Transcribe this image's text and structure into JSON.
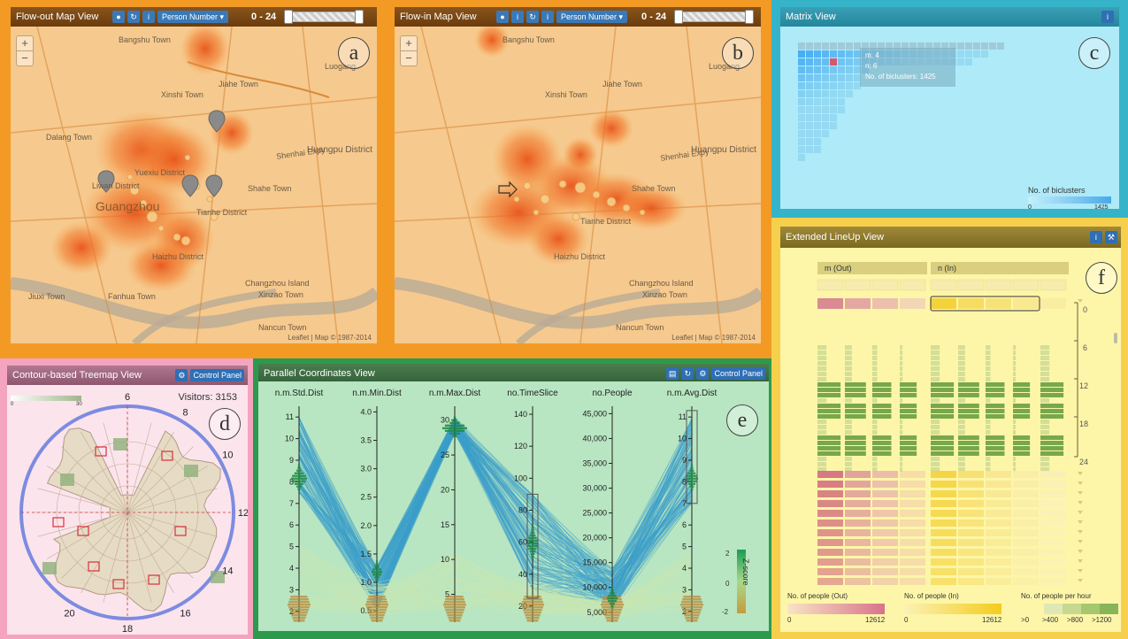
{
  "flow_out": {
    "title": "Flow-out Map View",
    "person_select": "Person Number ▾",
    "range": "0 - 24",
    "letter": "a",
    "attribution": "Leaflet | Map © 1987-2014",
    "labels": [
      "Bangshu Town",
      "Xinshi Town",
      "Jiahe Town",
      "Dalang Town",
      "Huangpu District",
      "Liwan District",
      "Shahe Town",
      "Tianhe District",
      "Yuexiu District",
      "Haizhu District",
      "Guangzhou",
      "Shenhai Expy",
      "Changzhou Island",
      "Xinzao Town",
      "Nancun Town",
      "Fanhua Town",
      "Jiuxi Town",
      "Luogang"
    ]
  },
  "flow_in": {
    "title": "Flow-in Map View",
    "person_select": "Person Number ▾",
    "range": "0 - 24",
    "letter": "b",
    "attribution": "Leaflet | Map © 1987-2014",
    "labels": [
      "Bangshu Town",
      "Xinshi Town",
      "Jiahe Town",
      "Huangpu District",
      "Shahe Town",
      "Tianhe District",
      "Haizhu District",
      "Shenhai Expy",
      "Changzhou Island",
      "Xinzao Town",
      "Nancun Town",
      "Luogang"
    ]
  },
  "matrix": {
    "title": "Matrix View",
    "letter": "c",
    "tooltip": {
      "m": "m: 4",
      "n": "n: 6",
      "biclusters": "No. of biclusters: 1425"
    },
    "legend_title": "No. of biclusters",
    "legend_min": "0",
    "legend_max": "1425"
  },
  "treemap": {
    "title": "Contour-based Treemap View",
    "control_panel": "Control Panel",
    "letter": "d",
    "visitors": "Visitors: 3153",
    "scale_left": "0",
    "scale_right": "30",
    "hour_labels": [
      "6",
      "8",
      "10",
      "12",
      "14",
      "16",
      "18",
      "20"
    ]
  },
  "parallel": {
    "title": "Parallel Coordinates View",
    "control_panel": "Control Panel",
    "letter": "e",
    "zscore_title": "Z-score",
    "zscore_ticks": [
      "2",
      "0",
      "-2"
    ],
    "axes": [
      {
        "name": "n.m.Std.Dist",
        "ticks": [
          "11",
          "10",
          "9",
          "8",
          "7",
          "6",
          "5",
          "4",
          "3",
          "2"
        ],
        "min": 1.5,
        "max": 11.5
      },
      {
        "name": "n.m.Min.Dist",
        "ticks": [
          "4.0",
          "3.5",
          "3.0",
          "2.5",
          "2.0",
          "1.5",
          "1.0",
          "0.5"
        ],
        "min": 0.3,
        "max": 4.1
      },
      {
        "name": "n.m.Max.Dist",
        "ticks": [
          "30",
          "25",
          "20",
          "15",
          "10",
          "5"
        ],
        "min": 1,
        "max": 32
      },
      {
        "name": "no.TimeSlice",
        "ticks": [
          "140",
          "120",
          "100",
          "80",
          "60",
          "40",
          "20"
        ],
        "min": 10,
        "max": 145
      },
      {
        "name": "no.People",
        "ticks": [
          "45,000",
          "40,000",
          "35,000",
          "30,000",
          "25,000",
          "20,000",
          "15,000",
          "10,000",
          "5,000"
        ],
        "min": 3000,
        "max": 46500
      },
      {
        "name": "n.m.Avg.Dist",
        "ticks": [
          "11",
          "10",
          "9",
          "8",
          "7",
          "6",
          "5",
          "4",
          "3",
          "2"
        ],
        "min": 1.5,
        "max": 11.5
      }
    ]
  },
  "lineup": {
    "title": "Extended LineUp View",
    "letter": "f",
    "col_out": "m (Out)",
    "col_in": "n (In)",
    "hour_ticks": [
      "0",
      "6",
      "12",
      "18",
      "24"
    ],
    "legend": {
      "out_title": "No. of people (Out)",
      "out_min": "0",
      "out_max": "12612",
      "in_title": "No. of people (In)",
      "in_min": "0",
      "in_max": "12612",
      "hour_title": "No. of people per hour",
      "hour_steps": [
        ">0",
        ">400",
        ">800",
        ">1200"
      ]
    }
  },
  "colors": {
    "orange_frame": "#f39a25",
    "cyan_frame": "#35b4c9",
    "pink_frame": "#f4a4bf",
    "green_frame": "#2c9a4c",
    "yellow_frame": "#f6d04c",
    "title_brown": "#7a4a14",
    "lineup_title": "#8a7426"
  },
  "icons": [
    "pin-icon",
    "refresh-icon",
    "info-icon",
    "bar-chart-icon",
    "settings-icon",
    "wrench-icon"
  ]
}
